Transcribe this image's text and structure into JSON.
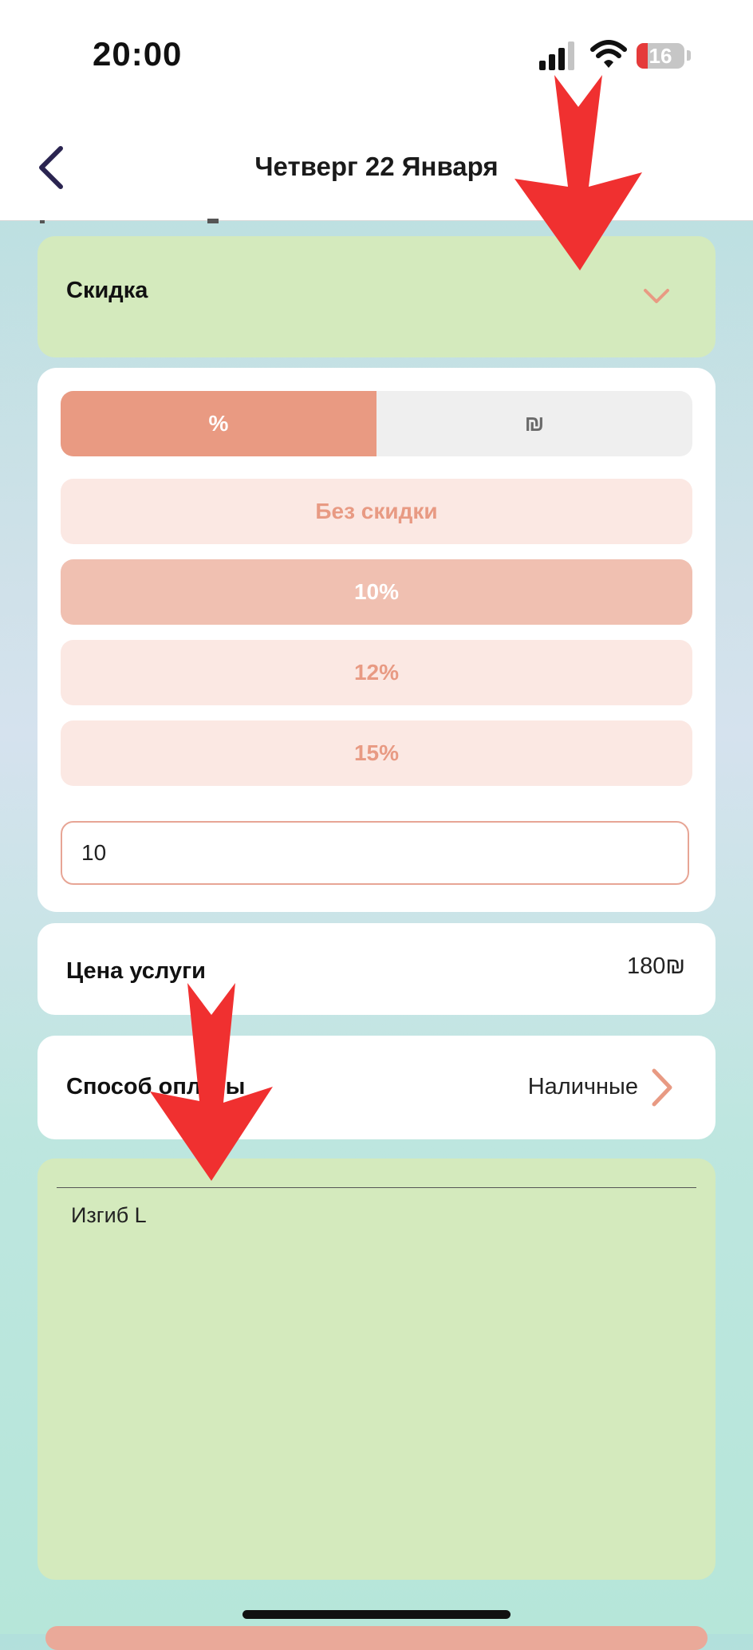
{
  "status_bar": {
    "time": "20:00",
    "battery": "16"
  },
  "header": {
    "title": "Четверг 22 Января",
    "back_icon": "chevron-left-icon"
  },
  "discount": {
    "section_label": "Скидка",
    "expand_icon": "chevron-down-icon",
    "mode_tabs": [
      {
        "label": "%",
        "selected": true
      },
      {
        "label": "₪",
        "selected": false
      }
    ],
    "options": [
      {
        "label": "Без скидки",
        "selected": false
      },
      {
        "label": "10%",
        "selected": true
      },
      {
        "label": "12%",
        "selected": false
      },
      {
        "label": "15%",
        "selected": false
      }
    ],
    "custom_value": "10"
  },
  "price": {
    "label": "Цена услуги",
    "value": "180₪"
  },
  "payment": {
    "label": "Способ оплаты",
    "value": "Наличные",
    "icon": "chevron-right-icon"
  },
  "notes": {
    "text": "Изгиб L"
  },
  "colors": {
    "accent": "#E99A82",
    "accent_light": "#FBE8E3",
    "selected_option": "#F0C0B1",
    "section_green": "#D4EABD",
    "annotation_arrow": "#F03030"
  }
}
